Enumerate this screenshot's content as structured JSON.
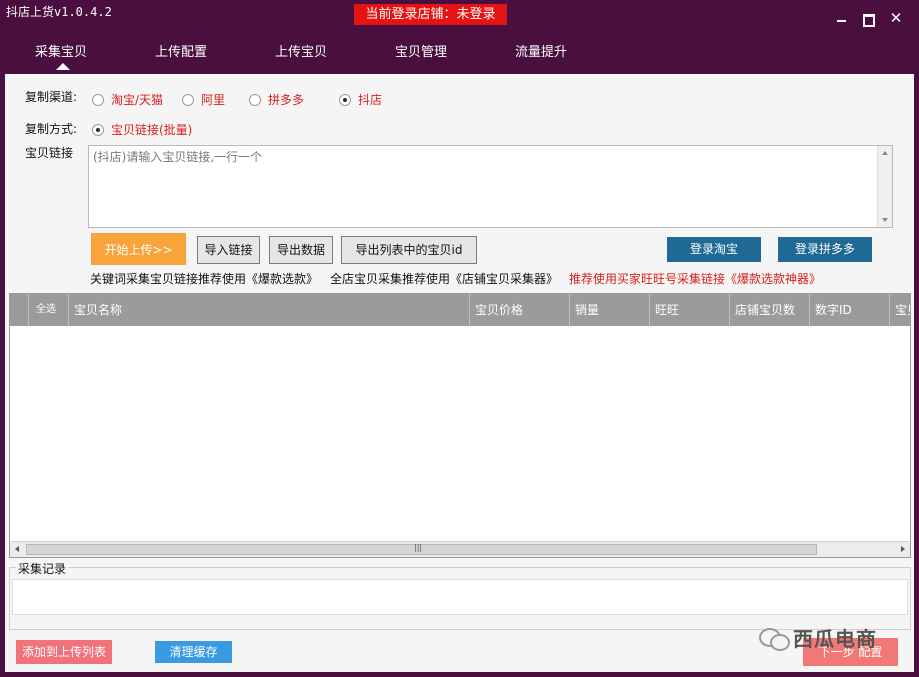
{
  "window": {
    "title": "抖店上货v1.0.4.2",
    "login_status": "当前登录店铺：未登录"
  },
  "nav": {
    "items": [
      "采集宝贝",
      "上传配置",
      "上传宝贝",
      "宝贝管理",
      "流量提升"
    ],
    "active": "采集宝贝"
  },
  "copy_channel": {
    "label": "复制渠道:",
    "options": [
      "淘宝/天猫",
      "阿里",
      "拼多多",
      "抖店"
    ],
    "selected": "抖店"
  },
  "copy_method": {
    "label": "复制方式:",
    "options": [
      "宝贝链接(批量)"
    ],
    "selected": "宝贝链接(批量)"
  },
  "links": {
    "label": "宝贝链接",
    "placeholder": "(抖店)请输入宝贝链接,一行一个"
  },
  "buttons": {
    "start_upload": "开始上传>>",
    "import_links": "导入链接",
    "export_data": "导出数据",
    "export_ids": "导出列表中的宝贝id",
    "login_taobao": "登录淘宝",
    "login_pdd": "登录拼多多"
  },
  "tips": {
    "keyword": "关键词采集宝贝链接推荐使用《爆款选款》",
    "shop": "全店宝贝采集推荐使用《店铺宝贝采集器》",
    "wangwang": "推荐使用买家旺旺号采集链接《爆款选款神器》"
  },
  "table": {
    "columns": [
      "全选",
      "宝贝名称",
      "宝贝价格",
      "销量",
      "旺旺",
      "店铺宝贝数",
      "数字ID",
      "宝贝"
    ],
    "rows": []
  },
  "record": {
    "title": "采集记录"
  },
  "bottom": {
    "add_to_upload": "添加到上传列表",
    "clear_cache": "清理缓存",
    "next_step": "下一步 配置"
  },
  "watermark": {
    "text": "西瓜电商",
    "icon": "wechat-icon"
  },
  "colors": {
    "frame": "#4a0f3e",
    "login_badge": "#e41414",
    "start_button": "#f9a43a",
    "login_button": "#1e6a94",
    "header_gray": "#9b9b9b",
    "pink_button": "#f0727a",
    "clear_button": "#3a9ae0",
    "red_text": "#d81e1e"
  }
}
